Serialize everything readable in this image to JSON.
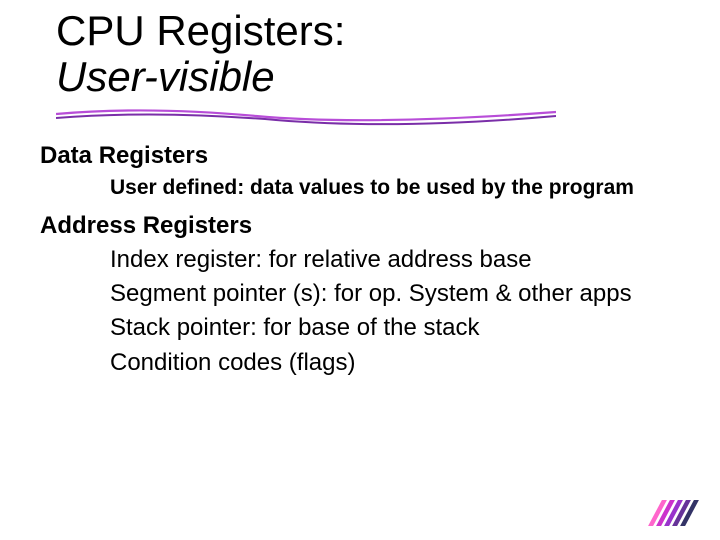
{
  "title": {
    "main": "CPU Registers:",
    "sub": "User-visible"
  },
  "sections": {
    "data_registers": {
      "heading": "Data Registers",
      "item": "User defined:  data values to be used by the program"
    },
    "address_registers": {
      "heading": "Address Registers",
      "items": [
        "Index register:  for relative address base",
        "Segment pointer (s):  for op. System & other apps",
        "Stack pointer:  for base of the stack",
        "Condition codes (flags)"
      ]
    }
  },
  "decor": {
    "slash_colors": [
      "#ff66cc",
      "#cc33cc",
      "#9933cc",
      "#663399",
      "#333366"
    ]
  }
}
